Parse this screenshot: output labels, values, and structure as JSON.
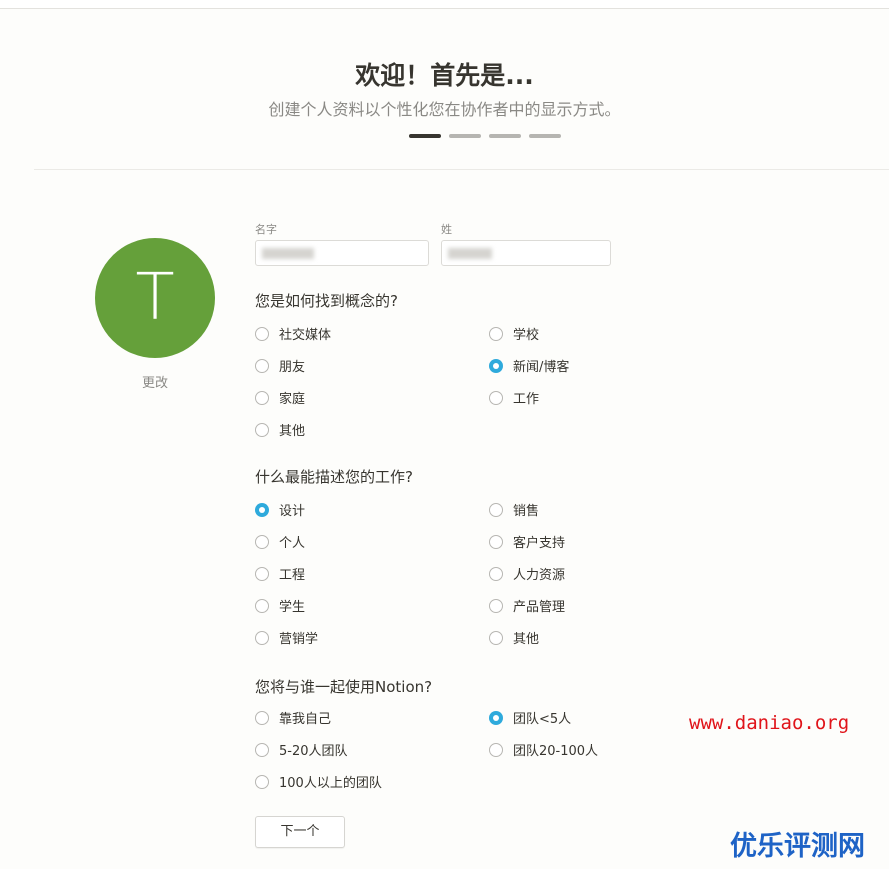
{
  "header": {
    "title": "欢迎！首先是...",
    "subtitle": "创建个人资料以个性化您在协作者中的显示方式。",
    "steps_total": 4,
    "step_active": 1
  },
  "profile": {
    "avatar_letter": "T",
    "avatar_color": "#65a03a",
    "change_label": "更改",
    "first_name_label": "名字",
    "last_name_label": "姓"
  },
  "questions": {
    "q1": {
      "label": "您是如何找到概念的?",
      "options": [
        "社交媒体",
        "学校",
        "朋友",
        "新闻/博客",
        "家庭",
        "工作",
        "其他"
      ],
      "selected": "新闻/博客"
    },
    "q2": {
      "label": "什么最能描述您的工作?",
      "options": [
        "设计",
        "销售",
        "个人",
        "客户支持",
        "工程",
        "人力资源",
        "学生",
        "产品管理",
        "营销学",
        "其他"
      ],
      "selected": "设计"
    },
    "q3": {
      "label": "您将与谁一起使用Notion?",
      "options": [
        "靠我自己",
        "团队<5人",
        "5-20人团队",
        "团队20-100人",
        "100人以上的团队"
      ],
      "selected": "团队<5人"
    }
  },
  "next_label": "下一个",
  "watermark": {
    "url": "www.daniao.org",
    "brand": "优乐评测网"
  },
  "colors": {
    "accent": "#2eaadc",
    "text": "#37352f",
    "muted": "#8a8985"
  }
}
